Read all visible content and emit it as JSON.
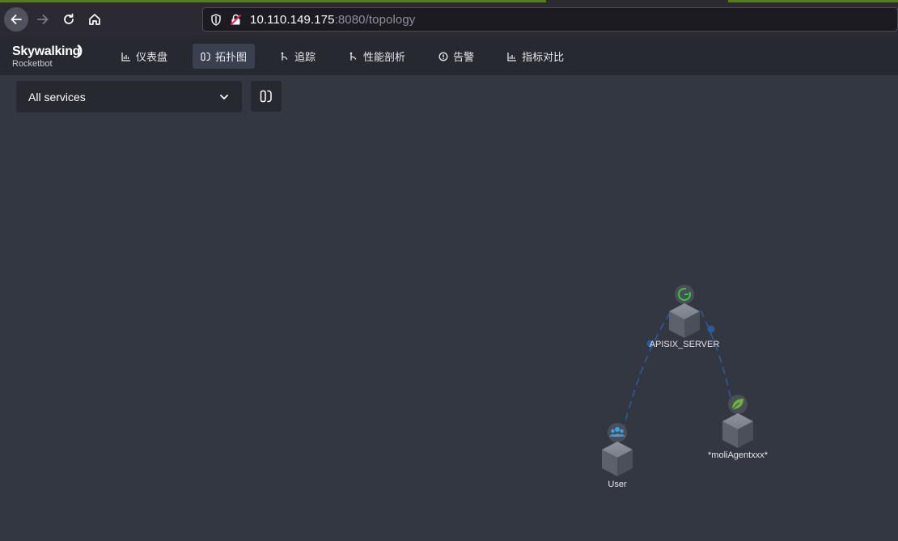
{
  "browser": {
    "url_host": "10.110.149.175",
    "url_rest": ":8080/topology"
  },
  "app": {
    "logo_main": "Skywalking",
    "logo_sub": "Rocketbot"
  },
  "nav": {
    "items": [
      {
        "label": "仪表盘",
        "icon": "chart-icon",
        "active": false
      },
      {
        "label": "拓扑图",
        "icon": "topology-icon",
        "active": true
      },
      {
        "label": "追踪",
        "icon": "trace-icon",
        "active": false
      },
      {
        "label": "性能剖析",
        "icon": "profile-icon",
        "active": false
      },
      {
        "label": "告警",
        "icon": "alarm-icon",
        "active": false
      },
      {
        "label": "指标对比",
        "icon": "compare-icon",
        "active": false
      }
    ]
  },
  "toolbar": {
    "service_select_value": "All services",
    "layout_button_icon": "layout-icon"
  },
  "topology": {
    "nodes": [
      {
        "name": "APISIX_SERVER",
        "type": "gateway",
        "icon": "gateway-g-icon",
        "badge_color": "#3fc23f"
      },
      {
        "name": "*moliAgentxxx*",
        "type": "spring",
        "icon": "spring-leaf-icon",
        "badge_color": "#6cb33e"
      },
      {
        "name": "User",
        "type": "user",
        "icon": "users-icon",
        "badge_color": "#3aa0e8"
      }
    ],
    "edges": [
      {
        "from": "User",
        "to": "APISIX_SERVER"
      },
      {
        "from": "APISIX_SERVER",
        "to": "*moliAgentxxx*"
      }
    ],
    "edge_color": "#2f5a9a"
  }
}
